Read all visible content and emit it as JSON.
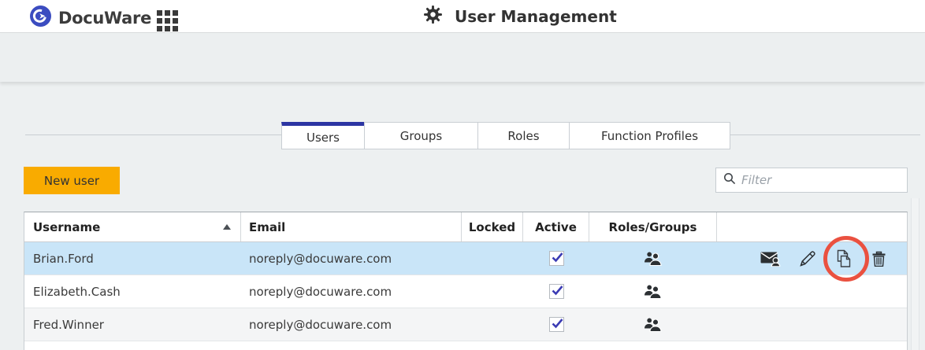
{
  "header": {
    "brand": "DocuWare",
    "title": "User Management"
  },
  "tabs": [
    {
      "label": "Users",
      "active": true
    },
    {
      "label": "Groups",
      "active": false
    },
    {
      "label": "Roles",
      "active": false
    },
    {
      "label": "Function Profiles",
      "active": false
    }
  ],
  "toolbar": {
    "new_user_label": "New user",
    "filter_placeholder": "Filter",
    "filter_value": ""
  },
  "table": {
    "columns": [
      "Username",
      "Email",
      "Locked",
      "Active",
      "Roles/Groups",
      ""
    ],
    "sort": {
      "column": "Username",
      "direction": "ascending"
    },
    "rows": [
      {
        "username": "Brian.Ford",
        "email": "noreply@docuware.com",
        "locked": false,
        "active": true,
        "selected": true,
        "actions": [
          "send-email",
          "edit",
          "copy",
          "delete"
        ]
      },
      {
        "username": "Elizabeth.Cash",
        "email": "noreply@docuware.com",
        "locked": false,
        "active": true,
        "selected": false
      },
      {
        "username": "Fred.Winner",
        "email": "noreply@docuware.com",
        "locked": false,
        "active": true,
        "selected": false
      }
    ]
  },
  "annotation": {
    "shape": "circle",
    "target": "copy",
    "color": "#ea5140"
  },
  "colors": {
    "brand_blue": "#3b4cc0",
    "active_tab_blue": "#2c35a3",
    "button_orange": "#f9ab00",
    "selected_row_blue": "#c9e5f8",
    "check_blue": "#3b3bb4",
    "annotation_red": "#ea5140"
  }
}
